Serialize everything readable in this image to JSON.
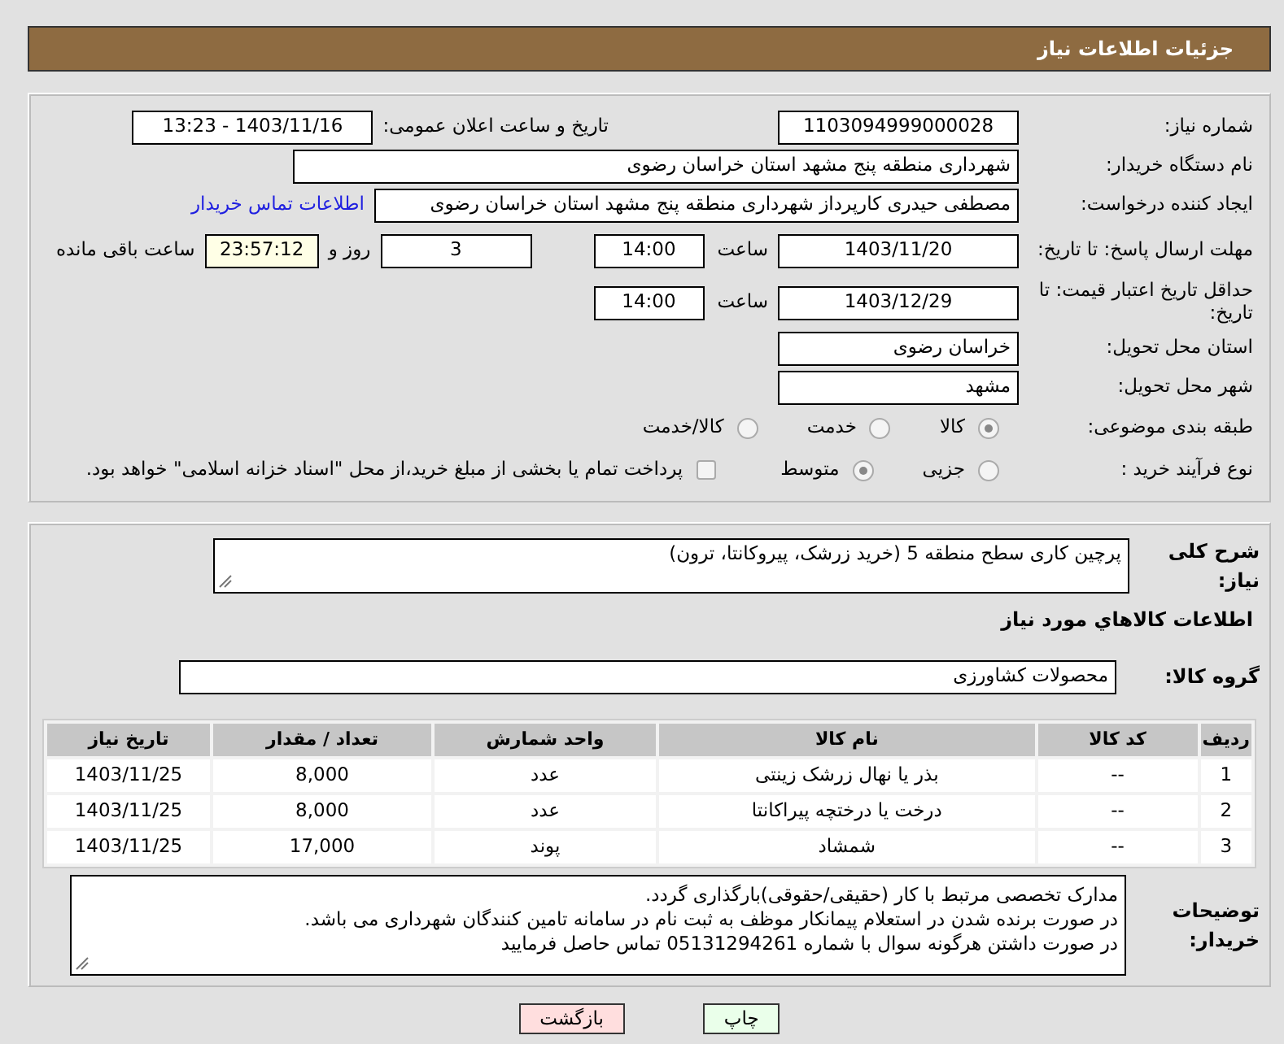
{
  "header": {
    "title": "جزئیات اطلاعات نیاز"
  },
  "need_number": {
    "label": "شماره نیاز:",
    "value": "1103094999000028"
  },
  "announce": {
    "label": "تاریخ و ساعت اعلان عمومی:",
    "value": "1403/11/16 - 13:23"
  },
  "buyer_org": {
    "label": "نام دستگاه خریدار:",
    "value": "شهرداری منطقه پنج مشهد استان خراسان رضوی"
  },
  "creator": {
    "label": "ایجاد کننده درخواست:",
    "value": "مصطفی حیدری کارپرداز شهرداری منطقه پنج مشهد استان خراسان رضوی",
    "link": "اطلاعات تماس خریدار"
  },
  "deadline": {
    "label": "مهلت ارسال پاسخ: تا تاریخ:",
    "date": "1403/11/20",
    "time_label": "ساعت",
    "time": "14:00",
    "days": "3",
    "days_label": "روز و",
    "remaining": "23:57:12",
    "remaining_label": "ساعت باقی مانده"
  },
  "validity": {
    "label": "حداقل تاریخ اعتبار قیمت: تا تاریخ:",
    "date": "1403/12/29",
    "time_label": "ساعت",
    "time": "14:00"
  },
  "province": {
    "label": "استان محل تحویل:",
    "value": "خراسان رضوی"
  },
  "city": {
    "label": "شهر محل تحویل:",
    "value": "مشهد"
  },
  "category": {
    "label": "طبقه بندی موضوعی:",
    "options": [
      {
        "label": "کالا",
        "selected": true
      },
      {
        "label": "خدمت",
        "selected": false
      },
      {
        "label": "کالا/خدمت",
        "selected": false
      }
    ]
  },
  "process": {
    "label": "نوع فرآیند خرید :",
    "options": [
      {
        "label": "جزیی",
        "selected": false
      },
      {
        "label": "متوسط",
        "selected": true
      }
    ],
    "payment": {
      "checked": false,
      "label": "پرداخت تمام یا بخشی از مبلغ خرید،از محل \"اسناد خزانه اسلامی\" خواهد بود."
    }
  },
  "description": {
    "label": "شرح کلی نیاز:",
    "value": "پرچین کاری سطح منطقه 5 (خرید زرشک، پیروکانتا، ترون)"
  },
  "items_title": "اطلاعات کالاهاي مورد نياز",
  "goods_group": {
    "label": "گروه کالا:",
    "value": "محصولات کشاورزی"
  },
  "table": {
    "columns": [
      "ردیف",
      "کد کالا",
      "نام کالا",
      "واحد شمارش",
      "تعداد / مقدار",
      "تاریخ نیاز"
    ],
    "rows": [
      [
        "1",
        "--",
        "بذر یا نهال زرشک زینتی",
        "عدد",
        "8,000",
        "1403/11/25"
      ],
      [
        "2",
        "--",
        "درخت یا درختچه پیراکانتا",
        "عدد",
        "8,000",
        "1403/11/25"
      ],
      [
        "3",
        "--",
        "شمشاد",
        "پوند",
        "17,000",
        "1403/11/25"
      ]
    ]
  },
  "buyer_notes": {
    "label": "توضیحات خریدار:",
    "lines": [
      "مدارک تخصصی مرتبط با کار (حقیقی/حقوقی)بارگذاری گردد.",
      "در صورت برنده شدن در استعلام پیمانکار موظف به ثبت نام در سامانه تامین کنندگان شهرداری می باشد.",
      "در صورت داشتن هرگونه سوال  با شماره 0513129426‬1 تماس حاصل فرمایید"
    ]
  },
  "buttons": [
    {
      "label": "چاپ",
      "kind": "print"
    },
    {
      "label": "بازگشت",
      "kind": "back"
    }
  ]
}
